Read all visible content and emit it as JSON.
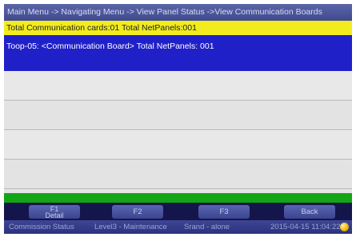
{
  "breadcrumb": "Main Menu -> Navigating Menu -> View Panel Status ->View Communication Boards",
  "summary": "Total Communication cards:01   Total NetPanels:001",
  "selected_row": "Toop-05: <Communication Board> Total NetPanels: 001",
  "function_keys": {
    "f1_top": "F1",
    "f1_bottom": "Detail",
    "f2": "F2",
    "f3": "F3",
    "back": "Back"
  },
  "status_bar": {
    "mode": "Commission Status",
    "access_level": "Level3 - Maintenance",
    "network": "Srand - alone",
    "datetime": "2015-04-15 11:04:22"
  },
  "colors": {
    "header": "#3f4a8f",
    "summary_bar": "#f2ec1e",
    "selection": "#2020c8",
    "green_bar": "#12a516",
    "status_indicator": "#f0b400"
  }
}
